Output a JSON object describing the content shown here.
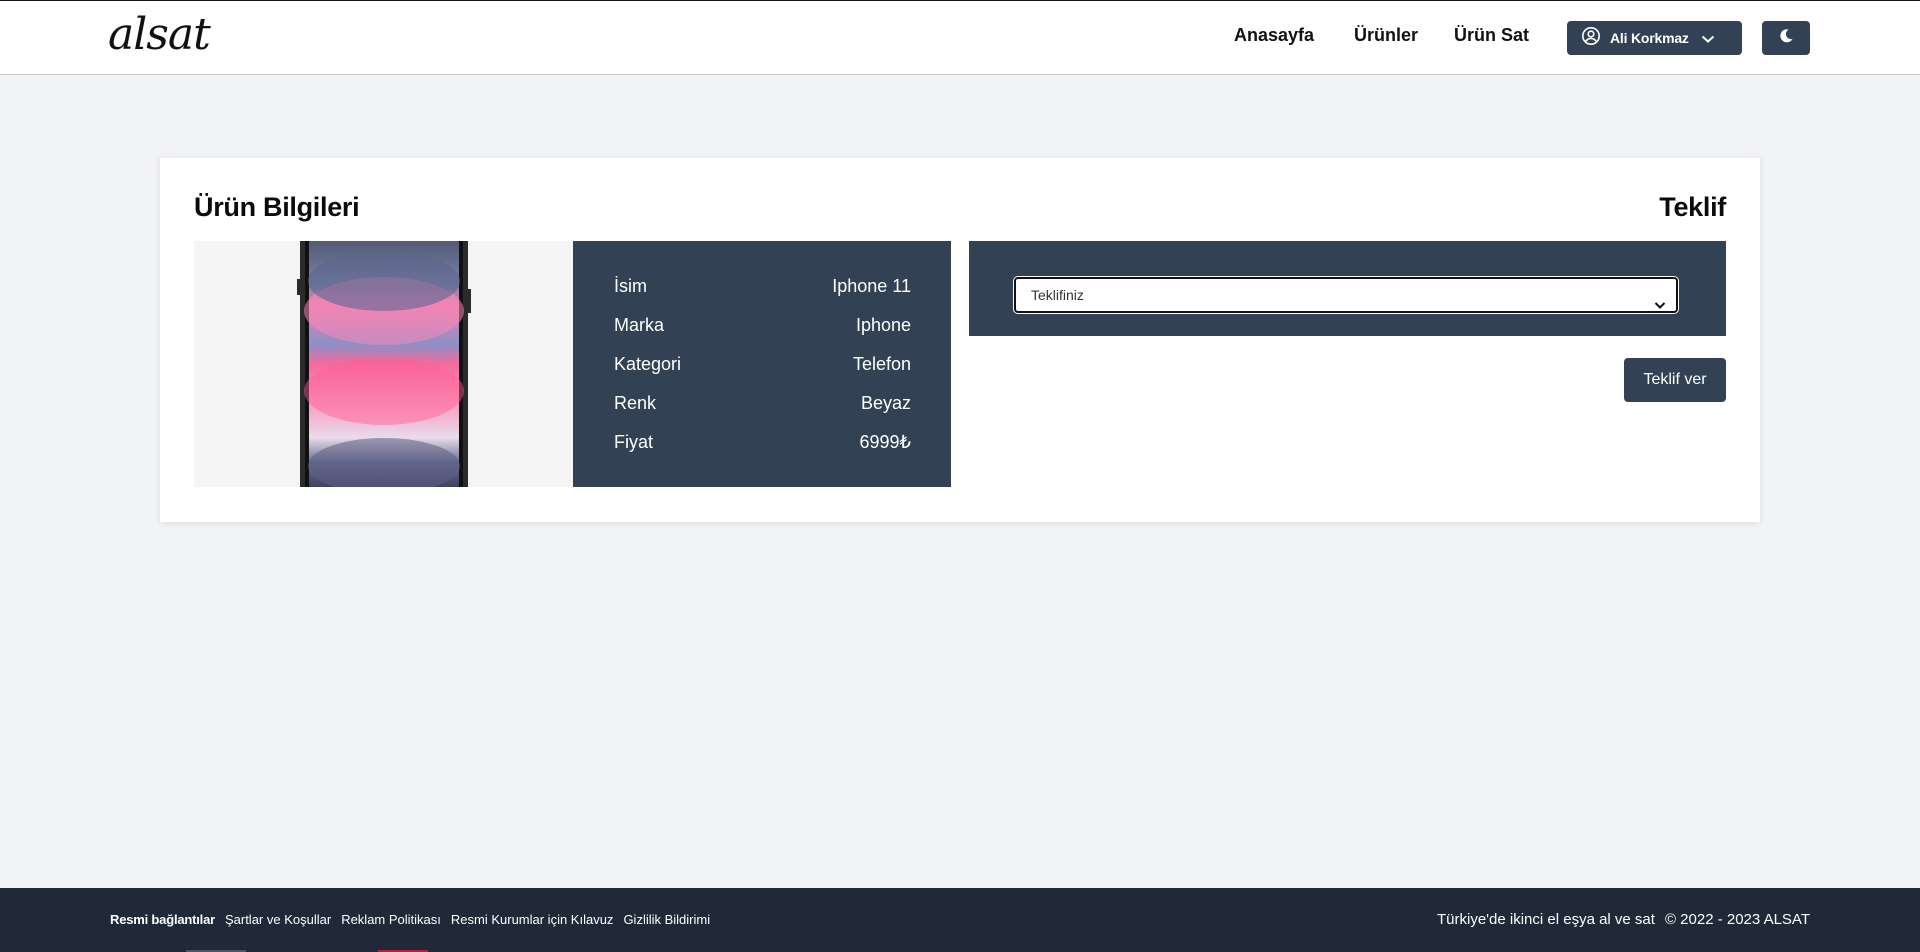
{
  "navbar": {
    "logo": "alsat",
    "links": [
      "Anasayfa",
      "Ürünler",
      "Ürün Sat"
    ],
    "user_name": "Ali Korkmaz",
    "icons": {
      "user": "user-circle-icon",
      "chevron": "chevron-down-icon",
      "theme": "moon-icon"
    }
  },
  "product": {
    "section_title": "Ürün Bilgileri",
    "image_alt": "Iphone 11",
    "fields": [
      {
        "label": "İsim",
        "value": "Iphone 11"
      },
      {
        "label": "Marka",
        "value": "Iphone"
      },
      {
        "label": "Kategori",
        "value": "Telefon"
      },
      {
        "label": "Renk",
        "value": "Beyaz"
      },
      {
        "label": "Fiyat",
        "value": "6999₺"
      }
    ]
  },
  "offer": {
    "section_title": "Teklif",
    "select_placeholder": "Teklifiniz",
    "submit_label": "Teklif ver"
  },
  "footer": {
    "heading": "Resmi bağlantılar",
    "links": [
      "Şartlar ve Koşullar",
      "Reklam Politikası",
      "Resmi Kurumlar için Kılavuz",
      "Gizlilik Bildirimi"
    ],
    "tagline": "Türkiye'de ikinci el eşya al ve sat",
    "copyright": "© 2022 - 2023 ALSAT"
  },
  "colors": {
    "primary": "#334155",
    "footer_bg": "#1f2937",
    "page_bg": "#f2f3f5"
  }
}
